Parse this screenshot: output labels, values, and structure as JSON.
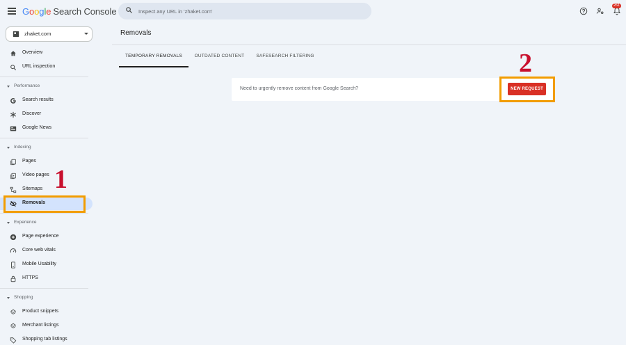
{
  "app": {
    "logo_letters": [
      "G",
      "o",
      "o",
      "g",
      "l",
      "e"
    ],
    "product_name": "Search Console"
  },
  "search": {
    "placeholder": "Inspect any URL in 'zhaket.com'"
  },
  "notifications": {
    "count": "261"
  },
  "property": {
    "label": "zhaket.com"
  },
  "sidebar": {
    "overview": "Overview",
    "url_inspection": "URL inspection",
    "performance": {
      "label": "Performance",
      "items": [
        "Search results",
        "Discover",
        "Google News"
      ]
    },
    "indexing": {
      "label": "Indexing",
      "items": [
        "Pages",
        "Video pages",
        "Sitemaps",
        "Removals"
      ]
    },
    "experience": {
      "label": "Experience",
      "items": [
        "Page experience",
        "Core web vitals",
        "Mobile Usability",
        "HTTPS"
      ]
    },
    "shopping": {
      "label": "Shopping",
      "items": [
        "Product snippets",
        "Merchant listings",
        "Shopping tab listings"
      ]
    }
  },
  "main": {
    "title": "Removals",
    "tabs": [
      "TEMPORARY REMOVALS",
      "OUTDATED CONTENT",
      "SAFESEARCH FILTERING"
    ],
    "card_text": "Need to urgently remove content from Google Search?",
    "new_request_label": "NEW REQUEST"
  },
  "annotations": {
    "first": "1",
    "second": "2"
  },
  "colors": {
    "background": "#f0f4f9",
    "active_nav": "#d3e3fd",
    "button_red": "#d93025",
    "highlight_orange": "#f29c00",
    "annotation_red": "#c8102e"
  }
}
